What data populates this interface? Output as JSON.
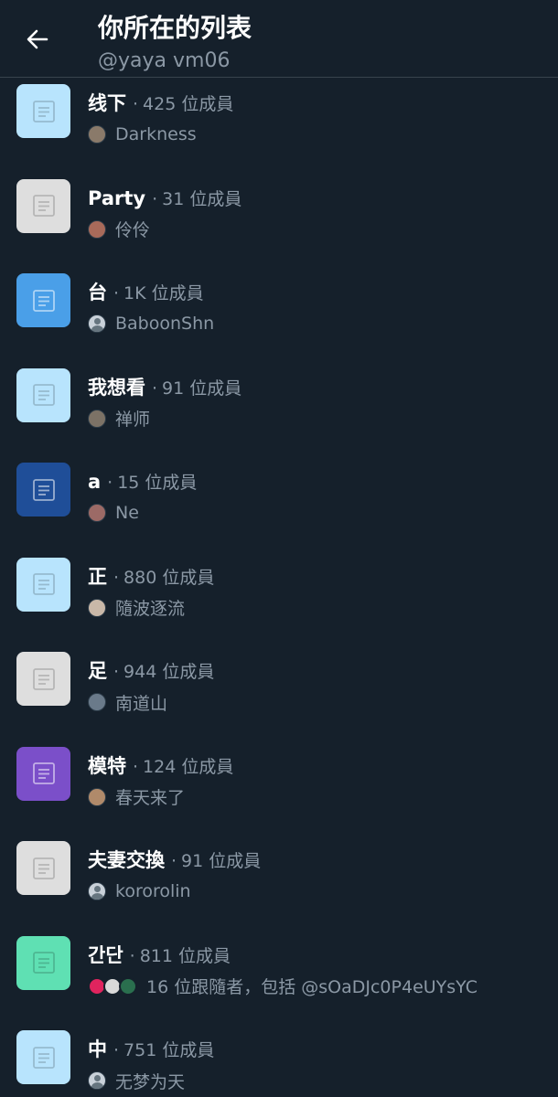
{
  "header": {
    "title": "你所在的列表",
    "handle": "@yaya vm06",
    "back_icon": "arrow-left-icon"
  },
  "colors": {
    "background": "#15202b",
    "muted_text": "#8b98a5",
    "divider": "#38444d"
  },
  "lists": [
    {
      "name": "线下",
      "separator": "·",
      "members": "425 位成員",
      "owner": "Darkness",
      "thumb_color": "#b8e4fd",
      "avatar_color": "#8a7a6a"
    },
    {
      "name": "Party",
      "separator": "·",
      "members": "31 位成員",
      "owner": "伶伶",
      "thumb_color": "#dedede",
      "avatar_color": "#a86a5a"
    },
    {
      "name": "台",
      "separator": "·",
      "members": "1K 位成員",
      "owner": "BaboonShn",
      "thumb_color": "#4a9fe8",
      "avatar_color": "default"
    },
    {
      "name": "我想看",
      "separator": "·",
      "members": "91 位成員",
      "owner": "禅师",
      "thumb_color": "#b8e4fd",
      "avatar_color": "#7c7266"
    },
    {
      "name": "a",
      "separator": "·",
      "members": "15 位成員",
      "owner": "Ne",
      "thumb_color": "#1f4e98",
      "avatar_color": "#9c6a66"
    },
    {
      "name": "正",
      "separator": "·",
      "members": "880 位成員",
      "owner": "隨波逐流",
      "thumb_color": "#b8e4fd",
      "avatar_color": "#c9b8a8"
    },
    {
      "name": "足",
      "separator": "·",
      "members": "944 位成員",
      "owner": "南道山",
      "thumb_color": "#dedede",
      "avatar_color": "#6a7a8a"
    },
    {
      "name": "模特",
      "separator": "·",
      "members": "124 位成員",
      "owner": "春天来了",
      "thumb_color": "#7b4fc9",
      "avatar_color": "#b08a6a"
    },
    {
      "name": "夫妻交換",
      "separator": "·",
      "members": "91 位成員",
      "owner": "kororolin",
      "thumb_color": "#dedede",
      "avatar_color": "default"
    },
    {
      "name": "간단",
      "separator": "·",
      "members": "811 位成員",
      "owner": "16 位跟隨者，包括 @sOaDJc0P4eUYsYC",
      "thumb_color": "#5fe0b3",
      "avatar_color": "stack"
    },
    {
      "name": "中",
      "separator": "·",
      "members": "751 位成員",
      "owner": "无梦为天",
      "thumb_color": "#b8e4fd",
      "avatar_color": "default"
    }
  ]
}
